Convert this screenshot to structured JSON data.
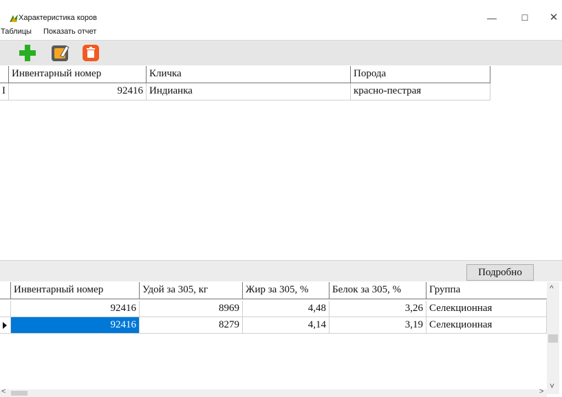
{
  "window": {
    "title": "Характеристика коров",
    "minimize": "—",
    "maximize": "☐",
    "close": "✕"
  },
  "menu": {
    "items": [
      "Таблицы",
      "Показать отчет"
    ]
  },
  "toolbar": {
    "add_icon": "plus-icon",
    "edit_icon": "edit-icon",
    "delete_icon": "delete-icon"
  },
  "top_grid": {
    "columns": [
      "Инвентарный номер",
      "Кличка",
      "Порода"
    ],
    "rows": [
      [
        "92416",
        "Индианка",
        "красно-пестрая"
      ]
    ],
    "row_indicator": "I"
  },
  "detail_button": "Подробно",
  "bottom_grid": {
    "columns": [
      "Инвентарный номер",
      "Удой за 305, кг",
      "Жир за 305, %",
      "Белок за 305, %",
      "Группа"
    ],
    "rows": [
      [
        "92416",
        "8969",
        "4,48",
        "3,26",
        "Селекционная"
      ],
      [
        "92416",
        "8279",
        "4,14",
        "3,19",
        "Селекционная"
      ]
    ],
    "selected_row": 1,
    "selection_color": "#0078d7"
  },
  "scroll": {
    "up": "^",
    "down": "˅",
    "left": "<",
    "right": ">"
  }
}
